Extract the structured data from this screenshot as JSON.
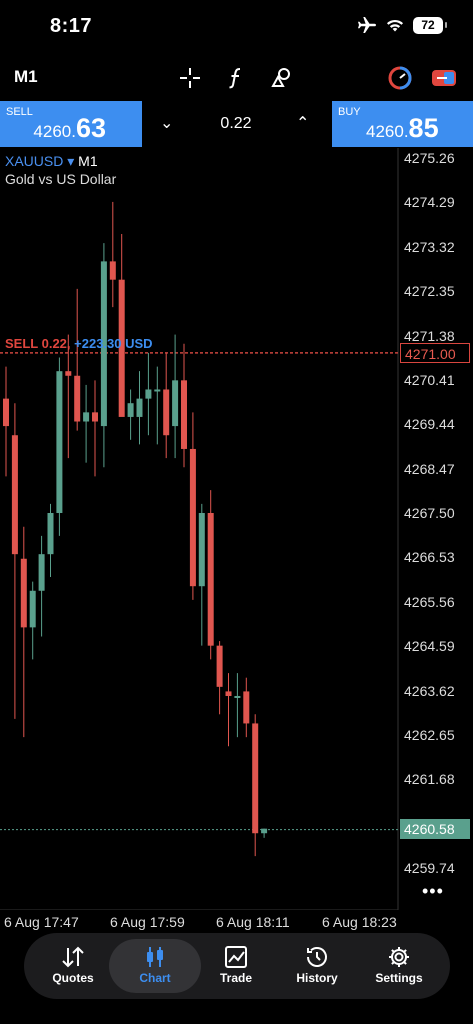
{
  "status": {
    "time": "8:17",
    "battery": "72"
  },
  "toolbar": {
    "timeframe": "M1"
  },
  "trade": {
    "sell_label": "SELL",
    "sell_small": "4260.",
    "sell_big": "63",
    "buy_label": "BUY",
    "buy_small": "4260.",
    "buy_big": "85",
    "lot": "0.22",
    "down_arrow": "⌄",
    "up_arrow": "⌃"
  },
  "chart": {
    "symbol": "XAUUSD",
    "symbol_arrow": "▾",
    "timeframe": "M1",
    "description": "Gold vs US Dollar",
    "position_sell": "SELL 0.22,",
    "position_profit": "+223.30 USD",
    "sell_tag": "4271.00",
    "bid_tag": "4260.58",
    "price_labels": [
      "4275.26",
      "4274.29",
      "4273.32",
      "4272.35",
      "4271.38",
      "4270.41",
      "4269.44",
      "4268.47",
      "4267.50",
      "4266.53",
      "4265.56",
      "4264.59",
      "4263.62",
      "4262.65",
      "4261.68",
      "4259.74"
    ],
    "time_labels": [
      "6 Aug 17:47",
      "6 Aug 17:59",
      "6 Aug 18:11",
      "6 Aug 18:23"
    ],
    "more": "•••",
    "colors": {
      "up": "#5aa08d",
      "down": "#e0564f",
      "accent": "#3d8ef0"
    }
  },
  "chart_data": {
    "type": "candlestick",
    "x": [
      "6 Aug 17:47",
      "6 Aug 17:59",
      "6 Aug 18:11",
      "6 Aug 18:23"
    ],
    "ylim": [
      4259.3,
      4275.5
    ],
    "candles": [
      {
        "o": 4270.0,
        "h": 4270.7,
        "l": 4268.3,
        "c": 4269.4
      },
      {
        "o": 4269.2,
        "h": 4269.9,
        "l": 4263.0,
        "c": 4266.6
      },
      {
        "o": 4266.5,
        "h": 4267.2,
        "l": 4262.6,
        "c": 4265.0
      },
      {
        "o": 4265.0,
        "h": 4266.0,
        "l": 4264.3,
        "c": 4265.8
      },
      {
        "o": 4265.8,
        "h": 4267.0,
        "l": 4264.8,
        "c": 4266.6
      },
      {
        "o": 4266.6,
        "h": 4267.7,
        "l": 4266.1,
        "c": 4267.5
      },
      {
        "o": 4267.5,
        "h": 4270.9,
        "l": 4267.0,
        "c": 4270.6
      },
      {
        "o": 4270.6,
        "h": 4271.4,
        "l": 4268.7,
        "c": 4270.5
      },
      {
        "o": 4270.5,
        "h": 4272.4,
        "l": 4269.3,
        "c": 4269.5
      },
      {
        "o": 4269.5,
        "h": 4270.3,
        "l": 4268.6,
        "c": 4269.7
      },
      {
        "o": 4269.7,
        "h": 4270.4,
        "l": 4268.3,
        "c": 4269.5
      },
      {
        "o": 4269.4,
        "h": 4273.4,
        "l": 4268.5,
        "c": 4273.0
      },
      {
        "o": 4273.0,
        "h": 4274.3,
        "l": 4272.0,
        "c": 4272.6
      },
      {
        "o": 4272.6,
        "h": 4273.6,
        "l": 4270.7,
        "c": 4269.6
      },
      {
        "o": 4269.6,
        "h": 4270.2,
        "l": 4269.1,
        "c": 4269.9
      },
      {
        "o": 4269.6,
        "h": 4270.6,
        "l": 4269.0,
        "c": 4270.0
      },
      {
        "o": 4270.0,
        "h": 4271.0,
        "l": 4269.2,
        "c": 4270.2
      },
      {
        "o": 4270.2,
        "h": 4270.7,
        "l": 4269.0,
        "c": 4270.2
      },
      {
        "o": 4270.2,
        "h": 4271.0,
        "l": 4268.7,
        "c": 4269.2
      },
      {
        "o": 4269.4,
        "h": 4271.4,
        "l": 4268.7,
        "c": 4270.4
      },
      {
        "o": 4270.4,
        "h": 4271.2,
        "l": 4268.5,
        "c": 4268.9
      },
      {
        "o": 4268.9,
        "h": 4269.7,
        "l": 4265.6,
        "c": 4265.9
      },
      {
        "o": 4265.9,
        "h": 4267.7,
        "l": 4264.6,
        "c": 4267.5
      },
      {
        "o": 4267.5,
        "h": 4268.0,
        "l": 4264.3,
        "c": 4264.6
      },
      {
        "o": 4264.6,
        "h": 4264.7,
        "l": 4263.1,
        "c": 4263.7
      },
      {
        "o": 4263.6,
        "h": 4264.0,
        "l": 4262.4,
        "c": 4263.5
      },
      {
        "o": 4263.5,
        "h": 4264.0,
        "l": 4262.6,
        "c": 4263.5
      },
      {
        "o": 4263.6,
        "h": 4263.9,
        "l": 4262.6,
        "c": 4262.9
      },
      {
        "o": 4262.9,
        "h": 4263.1,
        "l": 4260.0,
        "c": 4260.5
      },
      {
        "o": 4260.5,
        "h": 4260.6,
        "l": 4260.4,
        "c": 4260.6
      }
    ],
    "position_line": 4271.0,
    "bid_line": 4260.58
  },
  "nav": {
    "items": [
      {
        "label": "Quotes"
      },
      {
        "label": "Chart"
      },
      {
        "label": "Trade"
      },
      {
        "label": "History"
      },
      {
        "label": "Settings"
      }
    ]
  }
}
